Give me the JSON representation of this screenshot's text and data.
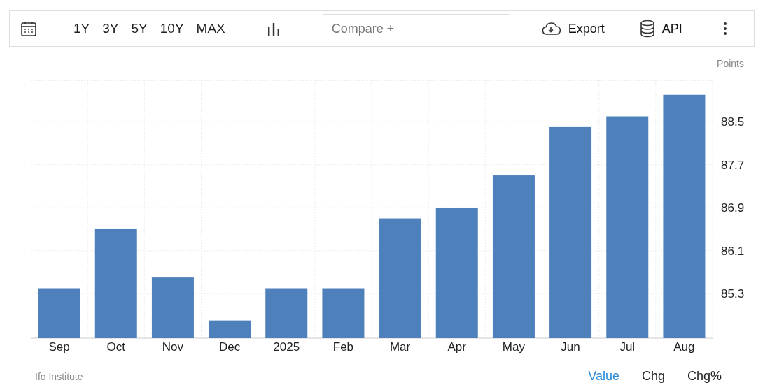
{
  "toolbar": {
    "ranges": [
      {
        "label": "1Y",
        "selected": false
      },
      {
        "label": "3Y",
        "selected": false
      },
      {
        "label": "5Y",
        "selected": false
      },
      {
        "label": "10Y",
        "selected": false
      },
      {
        "label": "MAX",
        "selected": false
      }
    ],
    "compare": {
      "placeholder": "Compare +"
    },
    "export": "Export",
    "api": "API"
  },
  "chart": {
    "unit": "Points",
    "chart_data": {
      "type": "bar",
      "categories": [
        "Sep",
        "Oct",
        "Nov",
        "Dec",
        "2025",
        "Feb",
        "Mar",
        "Apr",
        "May",
        "Jun",
        "Jul",
        "Aug"
      ],
      "values": [
        85.4,
        86.5,
        85.6,
        84.8,
        85.4,
        85.4,
        86.7,
        86.9,
        87.5,
        88.4,
        88.6,
        89.0
      ],
      "grid": true,
      "ylim": [
        84.47,
        89.27
      ],
      "yticks": [
        85.3,
        86.1,
        86.9,
        87.7,
        88.5
      ]
    }
  },
  "footer": {
    "source": "Ifo Institute",
    "modes": [
      {
        "label": "Value",
        "selected": true
      },
      {
        "label": "Chg",
        "selected": false
      },
      {
        "label": "Chg%",
        "selected": false
      }
    ]
  }
}
